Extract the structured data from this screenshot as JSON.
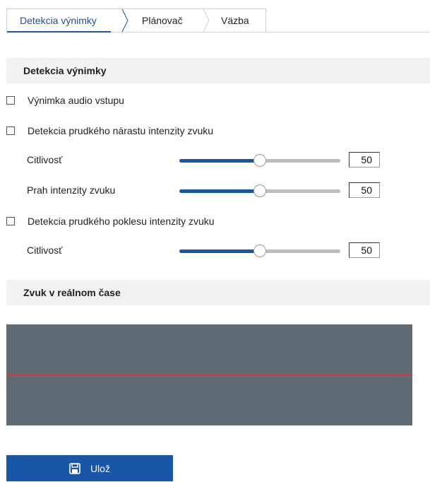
{
  "tabs": [
    {
      "label": "Detekcia výnimky",
      "active": true
    },
    {
      "label": "Plánovač",
      "active": false
    },
    {
      "label": "Väzba",
      "active": false
    }
  ],
  "sections": {
    "exception": "Detekcia výnimky",
    "realtime": "Zvuk v reálnom čase"
  },
  "options": {
    "audio_input_exception": {
      "label": "Výnimka audio vstupu",
      "checked": false
    },
    "sudden_increase": {
      "label": "Detekcia prudkého nárastu intenzity zvuku",
      "checked": false
    },
    "sudden_decrease": {
      "label": "Detekcia prudkého poklesu intenzity zvuku",
      "checked": false
    }
  },
  "sliders": {
    "increase_sensitivity": {
      "label": "Citlivosť",
      "value": "50",
      "fraction": 0.5
    },
    "increase_threshold": {
      "label": "Prah intenzity zvuku",
      "value": "50",
      "fraction": 0.5
    },
    "decrease_sensitivity": {
      "label": "Citlivosť",
      "value": "50",
      "fraction": 0.5
    }
  },
  "save": {
    "label": "Ulož",
    "icon": "floppy-disk-icon"
  },
  "colors": {
    "accent": "#1a56a6",
    "realtime_bg": "#5f6b75",
    "realtime_line": "#d93030"
  }
}
